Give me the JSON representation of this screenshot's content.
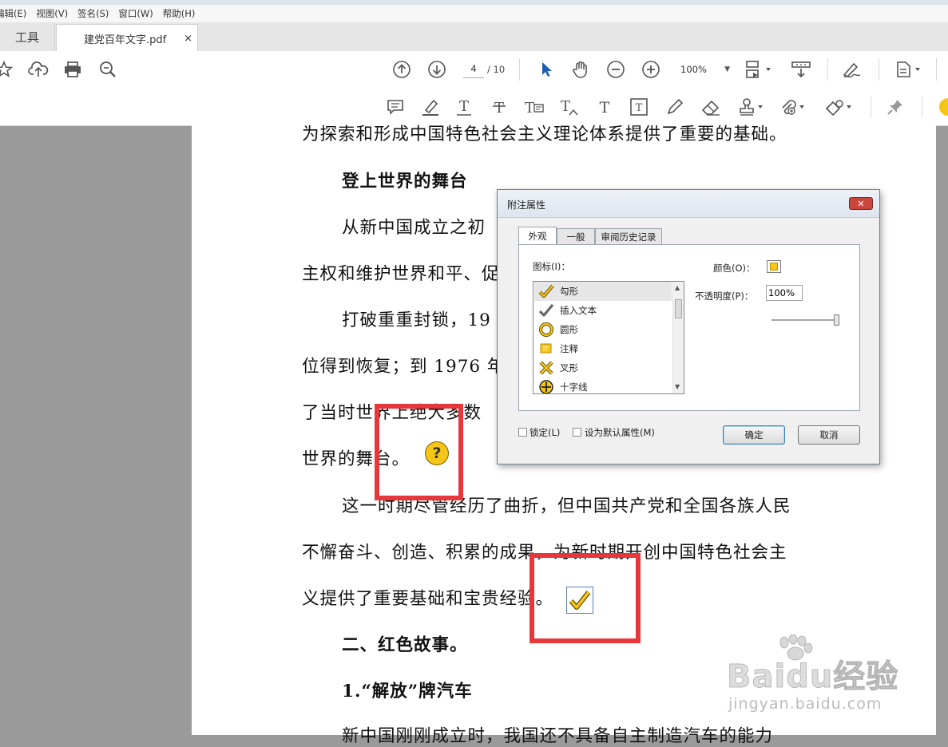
{
  "menubar": {
    "items": [
      "编辑(E)",
      "视图(V)",
      "签名(S)",
      "窗口(W)",
      "帮助(H)"
    ]
  },
  "tabs": {
    "tools": "工具",
    "document": "建党百年文字.pdf",
    "close": "×"
  },
  "toolbar": {
    "current_page": "4",
    "total_pages": "/ 10",
    "zoom": "100%",
    "icons": [
      "star-icon",
      "cloud-upload-icon",
      "print-icon",
      "search-zoom-icon",
      "page-up-icon",
      "page-down-icon",
      "select-cursor-icon",
      "hand-icon",
      "zoom-out-icon",
      "zoom-in-icon",
      "fit-page-icon",
      "scroll-mode-icon",
      "sign-icon",
      "page-options-icon"
    ]
  },
  "comment_toolbar": {
    "icons": [
      "sticky-note-icon",
      "highlight-icon",
      "underline-text-icon",
      "strikethrough-text-icon",
      "replace-text-icon",
      "insert-text-icon",
      "add-text-icon",
      "text-box-icon",
      "pencil-icon",
      "eraser-icon",
      "stamp-icon",
      "attach-file-icon",
      "shapes-icon",
      "pin-icon"
    ]
  },
  "document": {
    "lines": [
      "为探索和形成中国特色社会主义理论体系提供了重要的基础。",
      "登上世界的舞台",
      "从新中国成立之初",
      "主权和维护世界和平、促",
      "打破重重封锁，19",
      "位得到恢复；到 1976 年",
      "了当时世界上绝大多数",
      "世界的舞台。",
      "这一时期尽管经历了曲折，但中国共产党和全国各族人民",
      "不懈奋斗、创造、积累的成果，为新时期开创中国特色社会主",
      "义提供了重要基础和宝贵经验。",
      "二、红色故事。",
      "1.“解放”牌汽车",
      "新中国刚刚成立时，我国还不具备自主制造汽车的能力"
    ],
    "note_icon_symbol": "?",
    "highlight_color": "#e8373b"
  },
  "dialog": {
    "title": "附注属性",
    "close": "✕",
    "tabs": [
      "外观",
      "一般",
      "审阅历史记录"
    ],
    "icon_label": "图标(I)：",
    "icon_items": [
      "勾形",
      "插入文本",
      "圆形",
      "注释",
      "叉形",
      "十字线"
    ],
    "selected_icon": "勾形",
    "color_label": "颜色(O)：",
    "color_value": "#f5c518",
    "opacity_label": "不透明度(P)：",
    "opacity_value": "100%",
    "lock_label": "锁定(L)",
    "default_label": "设为默认属性(M)",
    "ok": "确定",
    "cancel": "取消"
  },
  "watermark": {
    "main": "Baidu经验",
    "sub": "jingyan.baidu.com"
  }
}
